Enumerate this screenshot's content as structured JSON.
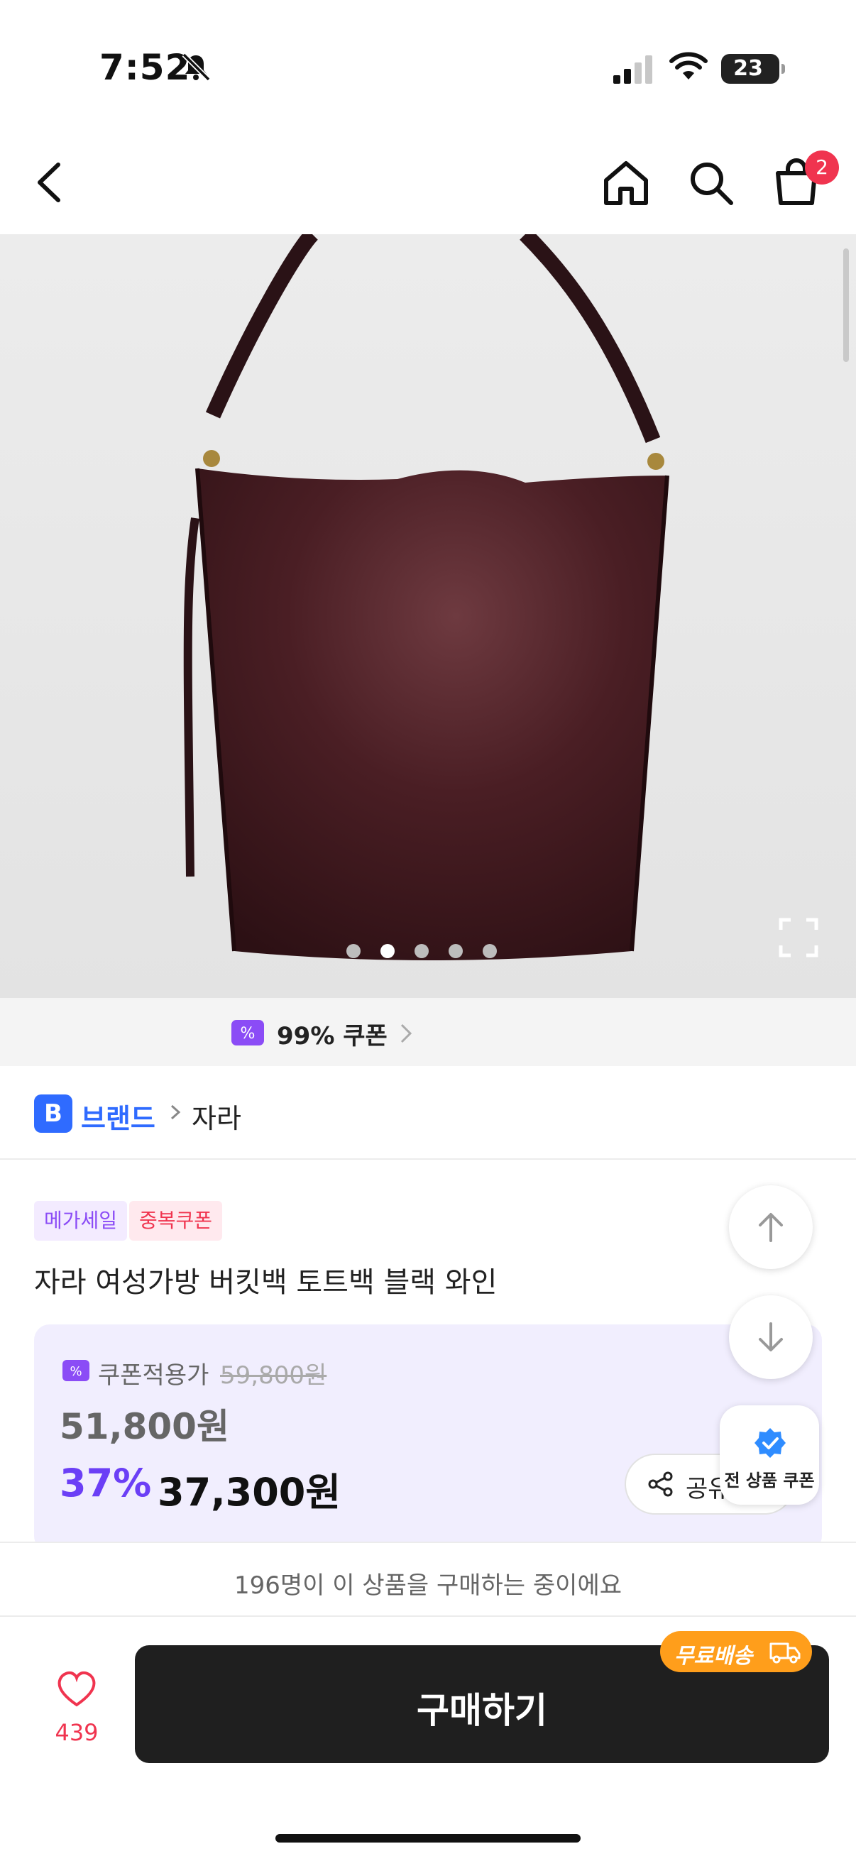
{
  "status_bar": {
    "time": "7:52",
    "battery": "23"
  },
  "nav": {
    "cart_count": "2"
  },
  "gallery": {
    "total_images": 5,
    "active_index": 1
  },
  "coupon_strip": {
    "label": "99% 쿠폰"
  },
  "brand": {
    "badge": "B",
    "label": "브랜드",
    "name": "자라"
  },
  "tags": [
    "메가세일",
    "중복쿠폰"
  ],
  "product": {
    "title": "자라 여성가방 버킷백 토트백 블랙 와인"
  },
  "price": {
    "coupon_label": "쿠폰적용가",
    "original": "59,800원",
    "sale": "51,800원",
    "discount_rate": "37%",
    "final": "37,300원",
    "share_label": "공유"
  },
  "floating": {
    "all_coupon_label": "전 상품 쿠폰"
  },
  "bottom": {
    "buyers_text": "196명이 이 상품을 구매하는 중이에요",
    "like_count": "439",
    "buy_label": "구매하기",
    "free_shipping": "무료배송"
  },
  "colors": {
    "accent_purple": "#6b3ff6",
    "brand_blue": "#2f6bff",
    "badge_red": "#f0344f",
    "ship_orange": "#ff9e1b",
    "bag_wine": "#3e1a1e"
  }
}
